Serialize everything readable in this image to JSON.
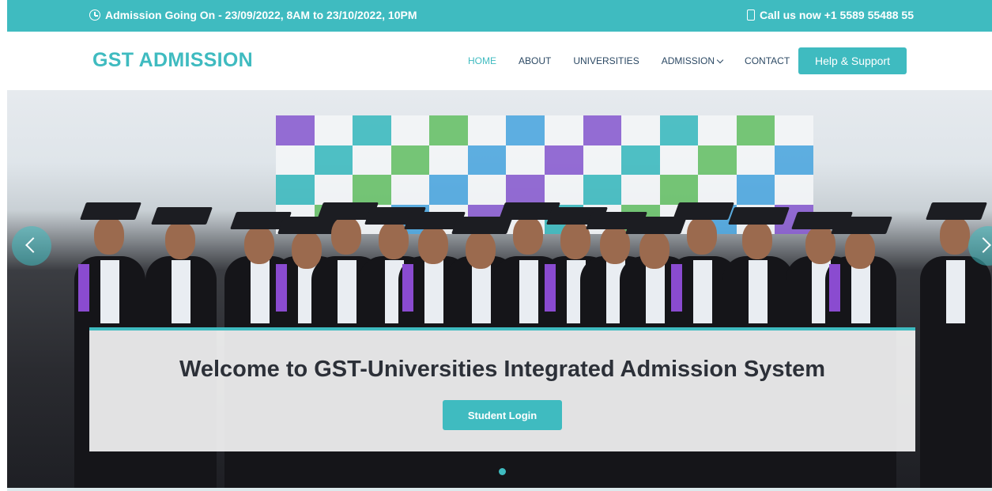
{
  "topbar": {
    "admission_text": "Admission Going On - 23/09/2022, 8AM to 23/10/2022, 10PM",
    "call_text": "Call us now +1 5589 55488 55",
    "bg_color": "#3fbbc0"
  },
  "header": {
    "logo": "GST ADMISSION",
    "nav": {
      "home": "HOME",
      "about": "ABOUT",
      "universities": "UNIVERSITIES",
      "admission": "ADMISSION",
      "contact": "CONTACT"
    },
    "help_button": "Help & Support"
  },
  "hero": {
    "welcome_title": "Welcome to GST-Universities Integrated Admission System",
    "login_button": "Student Login",
    "accent_color": "#3fbbc0",
    "carousel_active_index": 1,
    "carousel_dot_count": 1
  },
  "icons": {
    "clock": "clock-icon",
    "phone": "phone-icon",
    "chevron_down": "chevron-down-icon",
    "prev": "chevron-left-icon",
    "next": "chevron-right-icon"
  }
}
